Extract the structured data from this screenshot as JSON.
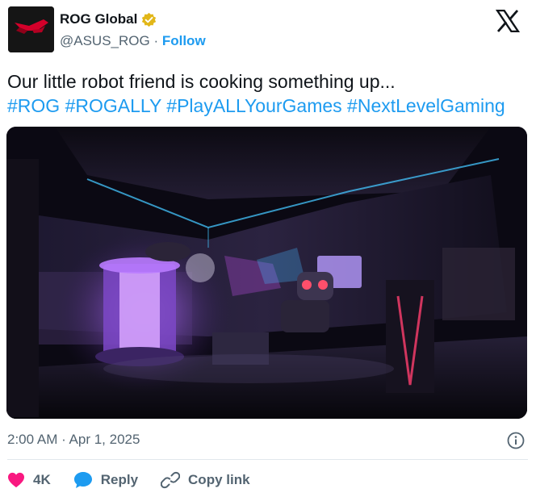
{
  "author": {
    "name": "ROG Global",
    "handle": "@ASUS_ROG",
    "separator": " · ",
    "follow_label": "Follow",
    "verified_badge": "gold-check-badge-icon",
    "avatar_logo_text": "ROG"
  },
  "post": {
    "text": "Our little robot friend is cooking something up...",
    "hashtags": [
      "#ROG",
      "#ROGALLY",
      "#PlayALLYourGames",
      "#NextLevelGaming"
    ],
    "media": "video-thumbnail-robot-in-gaming-room"
  },
  "meta": {
    "timestamp": "2:00 AM · Apr 1, 2025"
  },
  "actions": {
    "like_count": "4K",
    "reply_label": "Reply",
    "copy_link_label": "Copy link"
  },
  "colors": {
    "accent": "#1d9bf0",
    "like": "#f91880",
    "text": "#0f1419",
    "muted": "#536471",
    "badge": "#e2b719"
  }
}
